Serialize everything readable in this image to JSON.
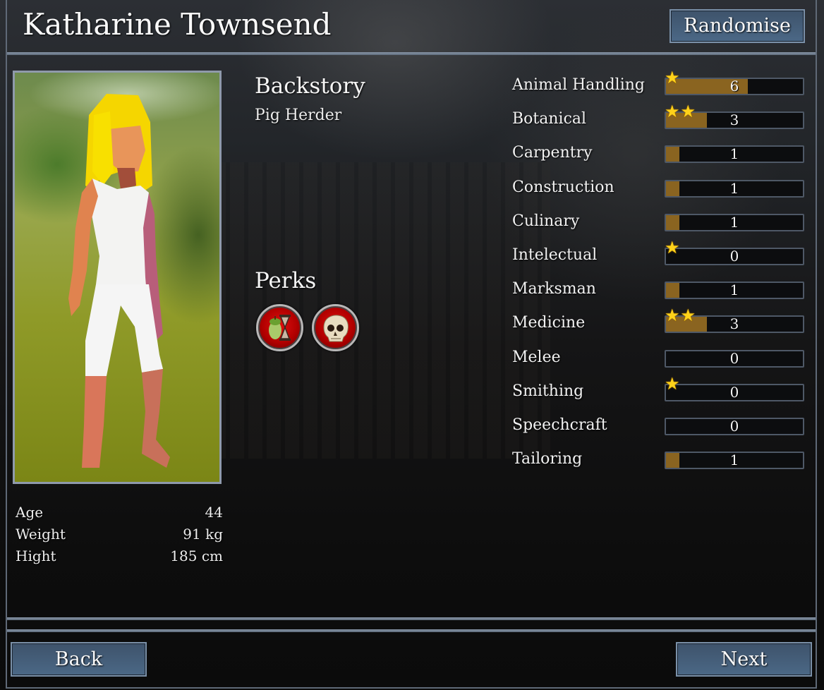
{
  "character": {
    "name": "Katharine Townsend",
    "backstory_heading": "Backstory",
    "backstory": "Pig Herder",
    "perks_heading": "Perks",
    "perks": [
      {
        "icon": "apple-core-hourglass-icon"
      },
      {
        "icon": "skull-icon"
      }
    ],
    "stats": [
      {
        "label": "Age",
        "value": "44"
      },
      {
        "label": "Weight",
        "value": "91 kg"
      },
      {
        "label": "Hight",
        "value": "185 cm"
      }
    ]
  },
  "buttons": {
    "randomise": "Randomise",
    "back": "Back",
    "next": "Next"
  },
  "skill_max": 10,
  "skills": [
    {
      "name": "Animal Handling",
      "value": "6",
      "level": 6,
      "stars": 1
    },
    {
      "name": "Botanical",
      "value": "3",
      "level": 3,
      "stars": 2
    },
    {
      "name": "Carpentry",
      "value": "1",
      "level": 1,
      "stars": 0
    },
    {
      "name": "Construction",
      "value": "1",
      "level": 1,
      "stars": 0
    },
    {
      "name": "Culinary",
      "value": "1",
      "level": 1,
      "stars": 0
    },
    {
      "name": "Intelectual",
      "value": "0",
      "level": 0,
      "stars": 1
    },
    {
      "name": "Marksman",
      "value": "1",
      "level": 1,
      "stars": 0
    },
    {
      "name": "Medicine",
      "value": "3",
      "level": 3,
      "stars": 2
    },
    {
      "name": "Melee",
      "value": "0",
      "level": 0,
      "stars": 0
    },
    {
      "name": "Smithing",
      "value": "0",
      "level": 0,
      "stars": 1
    },
    {
      "name": "Speechcraft",
      "value": "0",
      "level": 0,
      "stars": 0
    },
    {
      "name": "Tailoring",
      "value": "1",
      "level": 1,
      "stars": 0
    }
  ],
  "colors": {
    "bar_fill": "#8a6420",
    "button": "#45607e",
    "star": "#ffd21a",
    "perk_red": "#c00000"
  }
}
